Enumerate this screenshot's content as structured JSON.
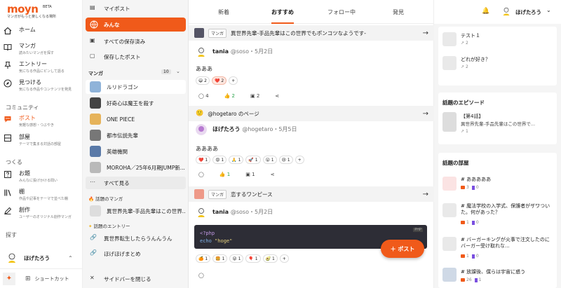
{
  "brand": {
    "name": "moyn",
    "beta": "BETA",
    "tagline": "マンガがもっと楽しくなる場所"
  },
  "nav": {
    "home": "ホーム",
    "manga": {
      "label": "マンガ",
      "sub": "読みたいマンガを探す"
    },
    "entry": {
      "label": "エントリー",
      "sub": "気になる作品にピンして語る"
    },
    "discover": {
      "label": "見つける",
      "sub": "気になる作品やコンテンツを発見"
    },
    "community_heading": "コミュニティ",
    "post": {
      "label": "ポスト",
      "sub": "気軽な感想・つぶやき"
    },
    "room": {
      "label": "部屋",
      "sub": "テーマで集まる対話の部屋"
    },
    "create_heading": "つくる",
    "odai": {
      "label": "お題",
      "sub": "みんなに投げかける問い"
    },
    "shelf": {
      "label": "棚",
      "sub": "作品や記事をテーマで並べた棚"
    },
    "sosaku": {
      "label": "創作",
      "sub": "ユーザーのオリジナル創作マンガ"
    },
    "explore_heading": "探す",
    "user": "ほげたろう",
    "shortcut": "ショートカット"
  },
  "sidebar": {
    "my_post": "マイポスト",
    "everyone": "みんな",
    "all_saved": "すべての保存済み",
    "saved_posts": "保存したポスト",
    "manga_heading": "マンガ",
    "manga_count": "10",
    "manga_items": [
      "ルリドラゴン",
      "好奇心は魔王を殺す",
      "ONE PIECE",
      "都市伝説先輩",
      "英雄機関",
      "MOROHA／25年6月期JUMP新..."
    ],
    "see_all": "すべて見る",
    "topic_manga_heading": "話題のマンガ",
    "topic_manga_item": "異世界先輩-手品先輩はこの世界...",
    "topic_entry_heading": "話題のエントリー",
    "topic_entries": [
      "異世界転生したらうんんうん",
      "ほげほげまとめ"
    ],
    "close": "サイドバーを閉じる"
  },
  "tabs": [
    "新着",
    "おすすめ",
    "フォロー中",
    "発見"
  ],
  "feed": {
    "post1": {
      "chip": "マンガ",
      "title": "異世界先輩-手品先輩はこの世界でもポンコツなようです-",
      "user": "tania",
      "handle": "@soso・5月2日",
      "text": "あああ",
      "reactions": [
        "😃 2",
        "❤️ 2",
        "+"
      ],
      "comments": "4",
      "likes": "2",
      "saves": "2"
    },
    "post2": {
      "page": "@hogetaro のページ",
      "user": "ほげたろう",
      "handle": "@hogetaro・5月5日",
      "text": "ああああ",
      "reactions": [
        "❤️ 1",
        "😡 1",
        "🙏 1",
        "🚀 1",
        "😮 1",
        "😢 1",
        "+"
      ],
      "likes": "1",
      "saves": "1"
    },
    "post3": {
      "chip": "マンガ",
      "title": "恋するワンピース",
      "user": "tania",
      "handle": "@soso・5月2日",
      "code_lang": "PHP",
      "code_line1": "<?php",
      "code_line2_kw": "echo",
      "code_line2_str": "\"hoge\"",
      "reactions": [
        "🍊 1",
        "🍔 1",
        "😜 1",
        "🎈 1",
        "🥑 1",
        "+"
      ]
    }
  },
  "fab": "＋ ポスト",
  "header_user": "ほげたろう",
  "right": {
    "list": [
      {
        "title": "テスト１",
        "count": "2"
      },
      {
        "title": "どれが好き？",
        "count": "2"
      }
    ],
    "episode_heading": "話題のエピソード",
    "episode": {
      "title": "【第4話】",
      "sub": "異世界先輩-手品先輩はこの世界で...",
      "count": "1"
    },
    "rooms_heading": "話題の部屋",
    "rooms": [
      {
        "title": "あああああ",
        "a": "3",
        "b": "0"
      },
      {
        "title": "魔法学校の入学式、保護者がザワついた。何があった？",
        "a": "1",
        "b": "0"
      },
      {
        "title": "バーガーキングが火事で注文したのにバーガー受け取れな...",
        "a": "1",
        "b": "0"
      },
      {
        "title": "放課後、僕らは宇宙に惑う",
        "a": "26",
        "b": "1"
      }
    ]
  },
  "colors": {
    "accent": "#f05a1a",
    "like_green": "#2aa24a",
    "bookmark_purple": "#7a4fe0"
  }
}
